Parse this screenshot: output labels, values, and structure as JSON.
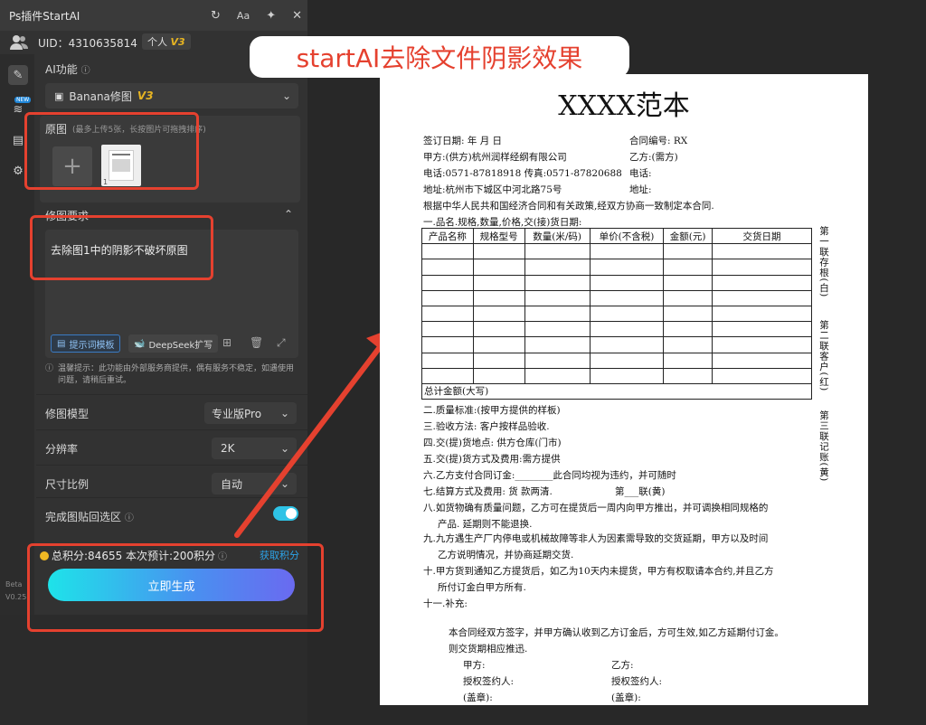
{
  "panel": {
    "title": "Ps插件StartAI",
    "font_btn": "Aa",
    "uid": "UID：4310635814",
    "plan": "个人",
    "plan_tier": "V3",
    "new_badge": "NEW",
    "beta": "Beta",
    "version": "V0.25",
    "ai_func_label": "AI功能",
    "func_select": "Banana修图",
    "func_tier": "V3",
    "upload_label": "原图",
    "upload_hint": "(最多上传5张，长按图片可拖拽排序)",
    "thumb_index": "1",
    "req_label": "修图要求",
    "req_text": "去除图1中的阴影不破坏原图",
    "btn_template": "提示词模板",
    "btn_deepseek": "DeepSeek扩写",
    "tip": "温馨提示：此功能由外部服务商提供，偶有服务不稳定，如遇使用问题，请稍后重试。",
    "rows": [
      {
        "label": "修图模型",
        "value": "专业版Pro"
      },
      {
        "label": "分辨率",
        "value": "2K"
      },
      {
        "label": "尺寸比例",
        "value": "自动"
      },
      {
        "label": "完成图贴回选区",
        "value": ""
      }
    ],
    "points": "总积分:84655  本次预计:200积分",
    "get_points": "获取积分",
    "generate": "立即生成"
  },
  "headline": "startAI去除文件阴影效果",
  "doc": {
    "title": "XXXX范本",
    "lines": [
      "签订日期:          年     月     日",
      "合同编号: RX",
      "甲方:(供方)杭州润样经纲有限公司",
      "乙方:(需方)",
      "电话:0571-87818918   传真:0571-87820688",
      "电话:",
      "地址:杭州市下城区中河北路75号",
      "地址:",
      "根据中华人民共和国经济合同和有关政策,经双方协商一致制定本合同.",
      "一.品名.规格,数量,价格,交(接)货日期:"
    ],
    "table_headers": [
      "产品名称",
      "规格型号",
      "数量(米/码)",
      "单价(不含税)",
      "金额(元)",
      "交货日期"
    ],
    "table_total": "总计金额(大写)",
    "side_labels": [
      "第一联存根(白)",
      "第二联客户(红)",
      "第三联记账(黄)"
    ],
    "clauses": [
      "二.质量标准:(按甲方提供的样板)",
      "三.验收方法: 客户按样品验收.",
      "四.交(提)货地点: 供方仓库(门市)",
      "五.交(提)货方式及费用:需方提供",
      "六.乙方支付合同订金:________此合同均视为违约，并可随时",
      "七.结算方式及费用: 货 款两清.",
      "第___联(黄)",
      "八.如货物确有质量问题，乙方可在提货后一周内向甲方推出，并可调换相同规格的",
      "产品. 延期则不能退换.",
      "九.九方遇生产厂内停电或机械故障等非人为因素需导致的交货延期，甲方以及时间",
      "乙方说明情况，并协商延期交货.",
      "十.甲方货到通知乙方提货后，如乙为10天内未提货，甲方有权取请本合约,并且乙方",
      "所付订金白甲方所有.",
      "十一.补充:",
      "本合同经双方签字，并甲方确认收到乙方订金后，方可生效,如乙方延期付订金。",
      "则交货期相应推迅.",
      "甲方:",
      "乙方:",
      "授权签约人:",
      "授权签约人:",
      "(盖章):",
      "(盖章):"
    ]
  }
}
